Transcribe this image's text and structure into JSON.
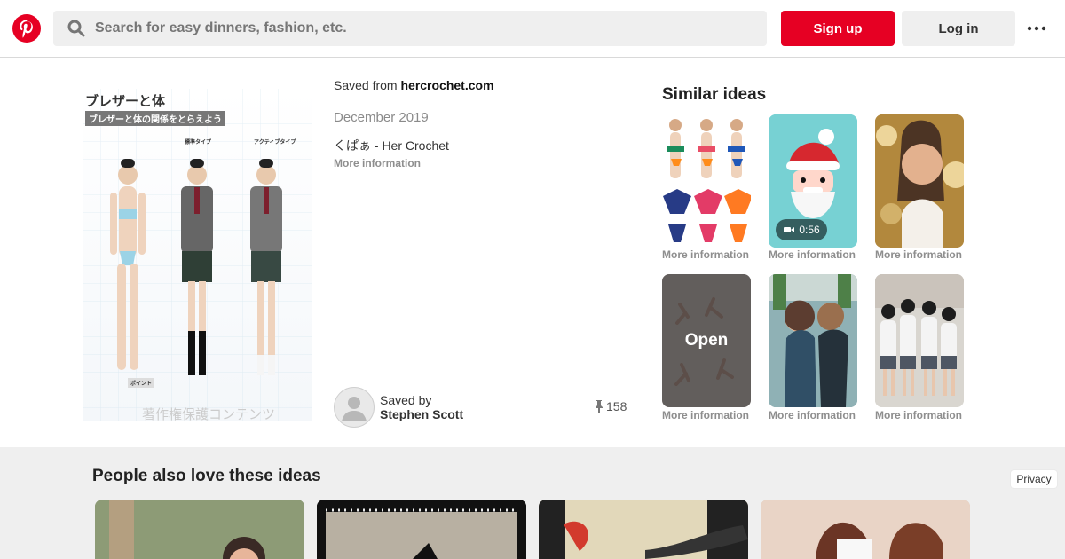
{
  "search": {
    "placeholder": "Search for easy dinners, fashion, etc."
  },
  "header": {
    "signup": "Sign up",
    "login": "Log in"
  },
  "pin": {
    "image_text": {
      "title": "ブレザーと体",
      "subtitle": "ブレザーと体の関係をとらえよう",
      "type_a": "標準タイプ",
      "type_b": "アクティブタイプ",
      "point": "ポイント",
      "watermark": "著作権保護コンテンツ"
    },
    "saved_from_prefix": "Saved from ",
    "saved_from_site": "hercrochet.com",
    "date": "December 2019",
    "title": "くぱぁ - Her Crochet",
    "more_information": "More information",
    "saved_by_label": "Saved by",
    "saver": "Stephen Scott",
    "repin_count": "158"
  },
  "similar": {
    "title": "Similar ideas",
    "tiles": [
      {
        "label": "More information"
      },
      {
        "label": "More information",
        "video_duration": "0:56"
      },
      {
        "label": "More information"
      },
      {
        "label": "More information",
        "open_label": "Open"
      },
      {
        "label": "More information"
      },
      {
        "label": "More information"
      }
    ]
  },
  "bottom": {
    "title": "People also love these ideas",
    "privacy": "Privacy"
  },
  "colors": {
    "brand": "#e60023",
    "muted": "#8e8e8e",
    "background": "#efefef"
  }
}
